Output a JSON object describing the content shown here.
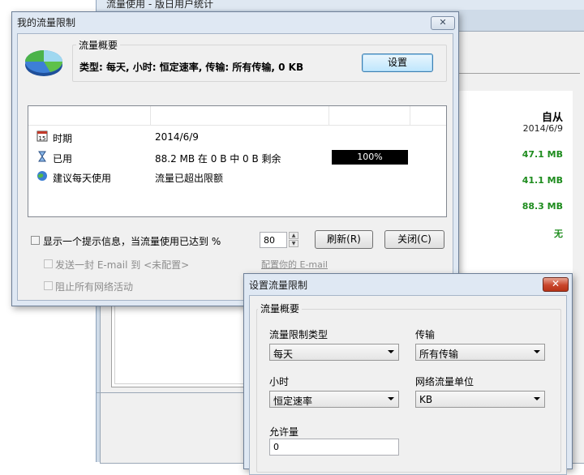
{
  "background_window": {
    "title": "流量使用 - 版日用户统计",
    "column_header": "自从",
    "column_date": "2014/6/9",
    "values": [
      "47.1 MB",
      "41.1 MB",
      "88.3 MB",
      "无"
    ]
  },
  "main_dialog": {
    "title": "我的流量限制",
    "close_label": "✕",
    "summary_group_label": "流量概要",
    "summary_text": "类型: 每天, 小时: 恒定速率, 传输: 所有传输, 0 KB",
    "settings_button": "设置",
    "rows": [
      {
        "icon": "calendar-icon",
        "label": "时期",
        "value": "2014/6/9"
      },
      {
        "icon": "hourglass-icon",
        "label": "已用",
        "value": "88.2 MB 在 0 B 中 0 B 剩余",
        "progress_label": "100%",
        "progress": 1.0
      },
      {
        "icon": "globe-icon",
        "label": "建议每天使用",
        "value": "流量已超出限额"
      }
    ],
    "notify_checkbox_label": "显示一个提示信息，当流量使用已达到 %",
    "notify_value": "80",
    "refresh_button": "刷新(R)",
    "close_button": "关闭(C)",
    "email_checkbox_label": "发送一封 E-mail 到 <未配置>",
    "email_link": "配置你的 E-mail",
    "block_checkbox_label": "阻止所有网络活动"
  },
  "set_dialog": {
    "title": "设置流量限制",
    "close_label": "✕",
    "group_label": "流量概要",
    "limit_type_label": "流量限制类型",
    "limit_type_value": "每天",
    "transfer_label": "传输",
    "transfer_value": "所有传输",
    "hour_label": "小时",
    "hour_value": "恒定速率",
    "unit_label": "网络流量单位",
    "unit_value": "KB",
    "allowance_label": "允许量",
    "allowance_value": "0"
  },
  "colors": {
    "value_green": "#1e8c1e",
    "progress_fill": "#000000",
    "window_frame": "#dfe8f3"
  }
}
